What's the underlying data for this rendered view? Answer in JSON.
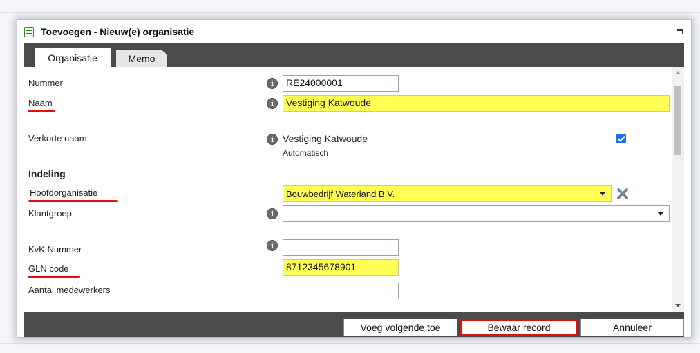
{
  "dialog": {
    "title": "Toevoegen - Nieuw(e) organisatie"
  },
  "tabs": [
    {
      "label": "Organisatie",
      "active": true
    },
    {
      "label": "Memo",
      "active": false
    }
  ],
  "form": {
    "nummer": {
      "label": "Nummer",
      "value": "RE24000001"
    },
    "naam": {
      "label": "Naam",
      "value": "Vestiging Katwoude"
    },
    "verkorte_naam": {
      "label": "Verkorte naam",
      "value": "Vestiging Katwoude",
      "note": "Automatisch",
      "auto_checked": true
    },
    "section_indeling": "Indeling",
    "hoofdorganisatie": {
      "label": "Hoofdorganisatie",
      "value": "Bouwbedrijf Waterland B.V."
    },
    "klantgroep": {
      "label": "Klantgroep",
      "value": ""
    },
    "kvk_nummer": {
      "label": "KvK Nummer",
      "value": ""
    },
    "gln_code": {
      "label": "GLN code",
      "value": "8712345678901"
    },
    "aantal_medewerkers": {
      "label": "Aantal medewerkers",
      "value": ""
    }
  },
  "footer": {
    "add_next_label": "Voeg volgende toe",
    "save_label": "Bewaar record",
    "cancel_label": "Annuleer"
  },
  "icons": {
    "title": "form-icon",
    "info": "info-icon",
    "clear": "clear-x-icon",
    "maximize": "maximize-icon"
  },
  "colors": {
    "required_field": "#ffff55",
    "highlight": "#e01010",
    "bar": "#4b4b4b",
    "checkbox": "#1a73e8"
  }
}
